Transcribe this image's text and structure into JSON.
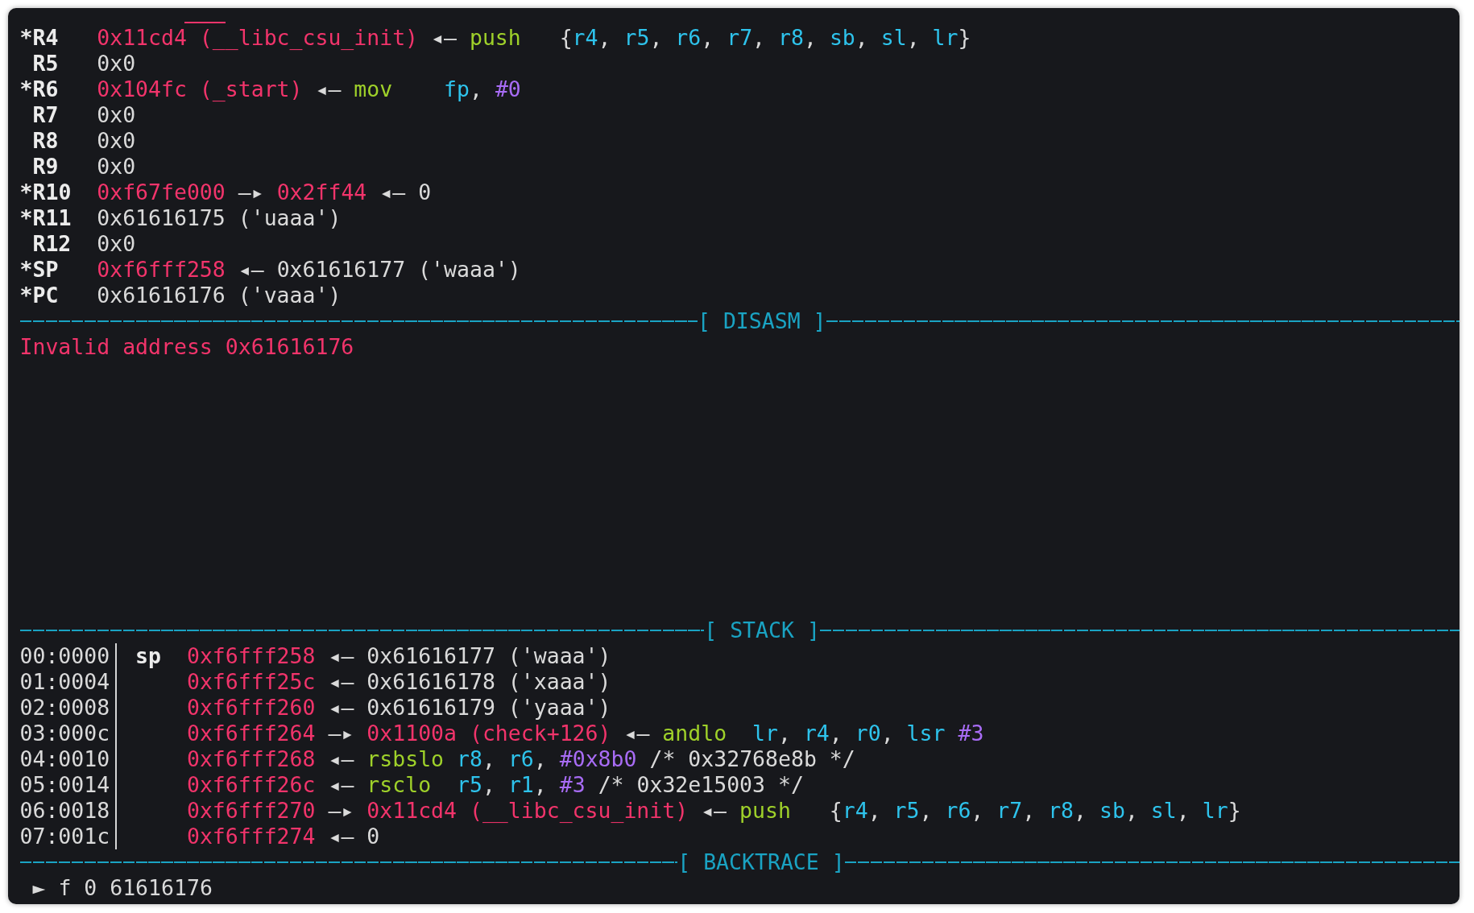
{
  "registers": [
    {
      "marker": "*",
      "name": "R4",
      "chain": [
        {
          "kind": "address",
          "text": "0x11cd4 (__libc_csu_init)"
        },
        {
          "kind": "left_arrow",
          "text": "◂—"
        },
        {
          "kind": "instruction",
          "mnemonic": "push",
          "separator": ",",
          "operands": [
            {
              "kind": "register_list",
              "open": "{",
              "close": "}",
              "registers": [
                "r4",
                "r5",
                "r6",
                "r7",
                "r8",
                "sb",
                "sl",
                "lr"
              ]
            }
          ]
        }
      ]
    },
    {
      "name": "R5",
      "chain": [
        {
          "kind": "value",
          "text": "0x0"
        }
      ]
    },
    {
      "marker": "*",
      "name": "R6",
      "chain": [
        {
          "kind": "address",
          "text": "0x104fc (_start)"
        },
        {
          "kind": "left_arrow",
          "text": "◂—"
        },
        {
          "kind": "instruction",
          "mnemonic": "mov",
          "separator": ",",
          "operands": [
            {
              "kind": "register",
              "text": "fp"
            },
            {
              "kind": "immediate",
              "text": "#0"
            }
          ]
        }
      ]
    },
    {
      "name": "R7",
      "chain": [
        {
          "kind": "value",
          "text": "0x0"
        }
      ]
    },
    {
      "name": "R8",
      "chain": [
        {
          "kind": "value",
          "text": "0x0"
        }
      ]
    },
    {
      "name": "R9",
      "chain": [
        {
          "kind": "value",
          "text": "0x0"
        }
      ]
    },
    {
      "marker": "*",
      "name": "R10",
      "chain": [
        {
          "kind": "address",
          "text": "0xf67fe000"
        },
        {
          "kind": "right_arrow",
          "text": "—▸"
        },
        {
          "kind": "address",
          "text": "0x2ff44"
        },
        {
          "kind": "left_arrow",
          "text": "◂—"
        },
        {
          "kind": "value",
          "text": "0"
        }
      ]
    },
    {
      "marker": "*",
      "name": "R11",
      "chain": [
        {
          "kind": "value",
          "text": "0x61616175 ('uaaa')"
        }
      ]
    },
    {
      "name": "R12",
      "chain": [
        {
          "kind": "value",
          "text": "0x0"
        }
      ]
    },
    {
      "marker": "*",
      "name": "SP",
      "chain": [
        {
          "kind": "address",
          "text": "0xf6fff258"
        },
        {
          "kind": "left_arrow",
          "text": "◂—"
        },
        {
          "kind": "value",
          "text": "0x61616177 ('waaa')"
        }
      ]
    },
    {
      "marker": "*",
      "name": "PC",
      "chain": [
        {
          "kind": "value",
          "text": "0x61616176 ('vaaa')"
        }
      ]
    }
  ],
  "disasm": {
    "title": "[ DISASM ]",
    "message": "Invalid address 0x61616176"
  },
  "stack": {
    "title": "[ STACK ]",
    "rows": [
      {
        "offset": "00:0000",
        "label": "sp",
        "chain": [
          {
            "kind": "address",
            "text": "0xf6fff258"
          },
          {
            "kind": "left_arrow",
            "text": "◂—"
          },
          {
            "kind": "value",
            "text": "0x61616177 ('waaa')"
          }
        ]
      },
      {
        "offset": "01:0004",
        "chain": [
          {
            "kind": "address",
            "text": "0xf6fff25c"
          },
          {
            "kind": "left_arrow",
            "text": "◂—"
          },
          {
            "kind": "value",
            "text": "0x61616178 ('xaaa')"
          }
        ]
      },
      {
        "offset": "02:0008",
        "chain": [
          {
            "kind": "address",
            "text": "0xf6fff260"
          },
          {
            "kind": "left_arrow",
            "text": "◂—"
          },
          {
            "kind": "value",
            "text": "0x61616179 ('yaaa')"
          }
        ]
      },
      {
        "offset": "03:000c",
        "chain": [
          {
            "kind": "address",
            "text": "0xf6fff264"
          },
          {
            "kind": "right_arrow",
            "text": "—▸"
          },
          {
            "kind": "address",
            "text": "0x1100a (check+126)"
          },
          {
            "kind": "left_arrow",
            "text": "◂—"
          },
          {
            "kind": "instruction",
            "mnemonic": "andlo",
            "separator": ",",
            "operands": [
              {
                "kind": "register",
                "text": "lr"
              },
              {
                "kind": "register",
                "text": "r4"
              },
              {
                "kind": "register",
                "text": "r0"
              },
              {
                "kind": "shift",
                "op": "lsr",
                "amount": "#3"
              }
            ]
          }
        ]
      },
      {
        "offset": "04:0010",
        "chain": [
          {
            "kind": "address",
            "text": "0xf6fff268"
          },
          {
            "kind": "left_arrow",
            "text": "◂—"
          },
          {
            "kind": "instruction",
            "mnemonic": "rsbslo",
            "separator": ",",
            "operands": [
              {
                "kind": "register",
                "text": "r8"
              },
              {
                "kind": "register",
                "text": "r6"
              },
              {
                "kind": "immediate",
                "text": "#0x8b0"
              }
            ],
            "comment": "/* 0x32768e8b */"
          }
        ]
      },
      {
        "offset": "05:0014",
        "chain": [
          {
            "kind": "address",
            "text": "0xf6fff26c"
          },
          {
            "kind": "left_arrow",
            "text": "◂—"
          },
          {
            "kind": "instruction",
            "mnemonic": "rsclo",
            "separator": ",",
            "operands": [
              {
                "kind": "register",
                "text": "r5"
              },
              {
                "kind": "register",
                "text": "r1"
              },
              {
                "kind": "immediate",
                "text": "#3"
              }
            ],
            "comment": "/* 0x32e15003 */"
          }
        ]
      },
      {
        "offset": "06:0018",
        "chain": [
          {
            "kind": "address",
            "text": "0xf6fff270"
          },
          {
            "kind": "right_arrow",
            "text": "—▸"
          },
          {
            "kind": "address",
            "text": "0x11cd4 (__libc_csu_init)"
          },
          {
            "kind": "left_arrow",
            "text": "◂—"
          },
          {
            "kind": "instruction",
            "mnemonic": "push",
            "separator": ",",
            "operands": [
              {
                "kind": "register_list",
                "open": "{",
                "close": "}",
                "registers": [
                  "r4",
                  "r5",
                  "r6",
                  "r7",
                  "r8",
                  "sb",
                  "sl",
                  "lr"
                ]
              }
            ]
          }
        ]
      },
      {
        "offset": "07:001c",
        "chain": [
          {
            "kind": "address",
            "text": "0xf6fff274"
          },
          {
            "kind": "left_arrow",
            "text": "◂—"
          },
          {
            "kind": "value",
            "text": "0"
          }
        ]
      }
    ]
  },
  "backtrace": {
    "title": "[ BACKTRACE ]",
    "frames": [
      {
        "marker": "►",
        "text": "f 0 61616176"
      }
    ]
  }
}
